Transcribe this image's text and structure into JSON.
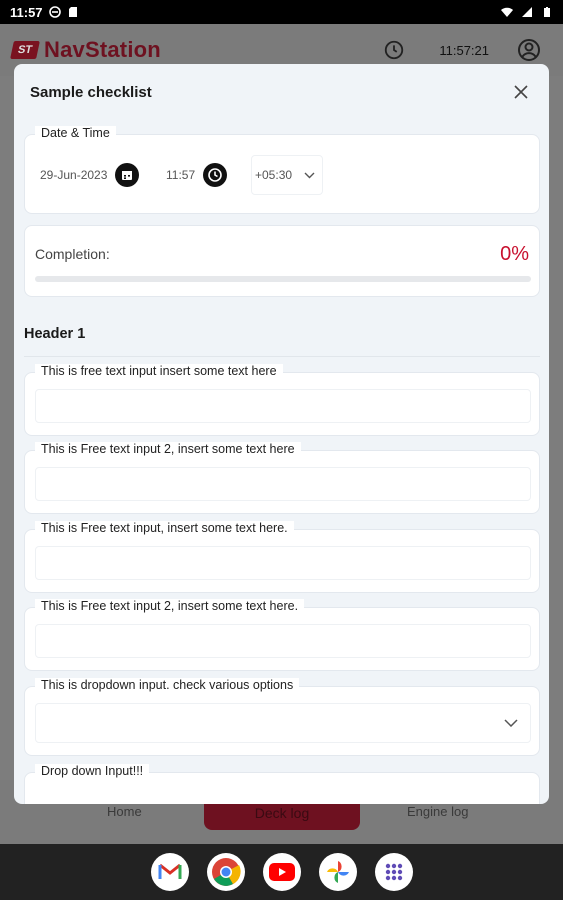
{
  "statusbar": {
    "time": "11:57"
  },
  "app": {
    "logo_badge": "ST",
    "logo_text": "NavStation",
    "time": "11:57:21"
  },
  "tabs": {
    "home": "Home",
    "deck_log": "Deck log",
    "engine_log": "Engine log"
  },
  "modal": {
    "title": "Sample checklist",
    "datetime": {
      "legend": "Date & Time",
      "date": "29-Jun-2023",
      "time": "11:57",
      "timezone": "+05:30"
    },
    "completion": {
      "label": "Completion:",
      "value": "0%",
      "percent": 0
    },
    "section_title": "Header 1",
    "fields": [
      {
        "label": "This is free text input insert some text here",
        "value": ""
      },
      {
        "label": "This is Free text input 2, insert some text here",
        "value": ""
      },
      {
        "label": "This is Free text input, insert some text here.",
        "value": ""
      },
      {
        "label": "This is Free text input 2, insert some text here.",
        "value": ""
      }
    ],
    "dropdown": {
      "label": "This is dropdown input. check various options",
      "value": ""
    },
    "clipped_label": "Drop down Input!!!"
  },
  "colors": {
    "brand": "#6e1120",
    "accent": "#c8102e",
    "modal_bg": "#f0f4f8"
  },
  "dock": [
    "gmail-icon",
    "chrome-icon",
    "youtube-icon",
    "photos-icon",
    "apps-icon"
  ]
}
